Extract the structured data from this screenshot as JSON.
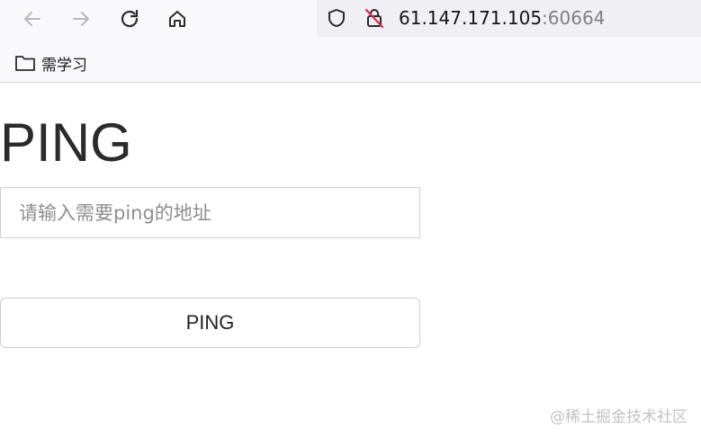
{
  "browser": {
    "url_host": "61.147.171.105",
    "url_port": ":60664",
    "bookmarks": [
      {
        "label": "需学习",
        "icon": "folder-icon"
      }
    ],
    "nav_icons": [
      "back-arrow-icon",
      "forward-arrow-icon",
      "reload-icon",
      "home-icon"
    ],
    "url_icons": [
      "shield-icon",
      "insecure-lock-icon"
    ],
    "colors": {
      "chrome_bg": "#f9f9fb",
      "urlbar_bg": "#f0f0f4",
      "insecure_slash": "#e22850"
    }
  },
  "page": {
    "title": "PING",
    "input_placeholder": "请输入需要ping的地址",
    "input_value": "",
    "button_label": "PING"
  },
  "watermark": "@稀土掘金技术社区"
}
